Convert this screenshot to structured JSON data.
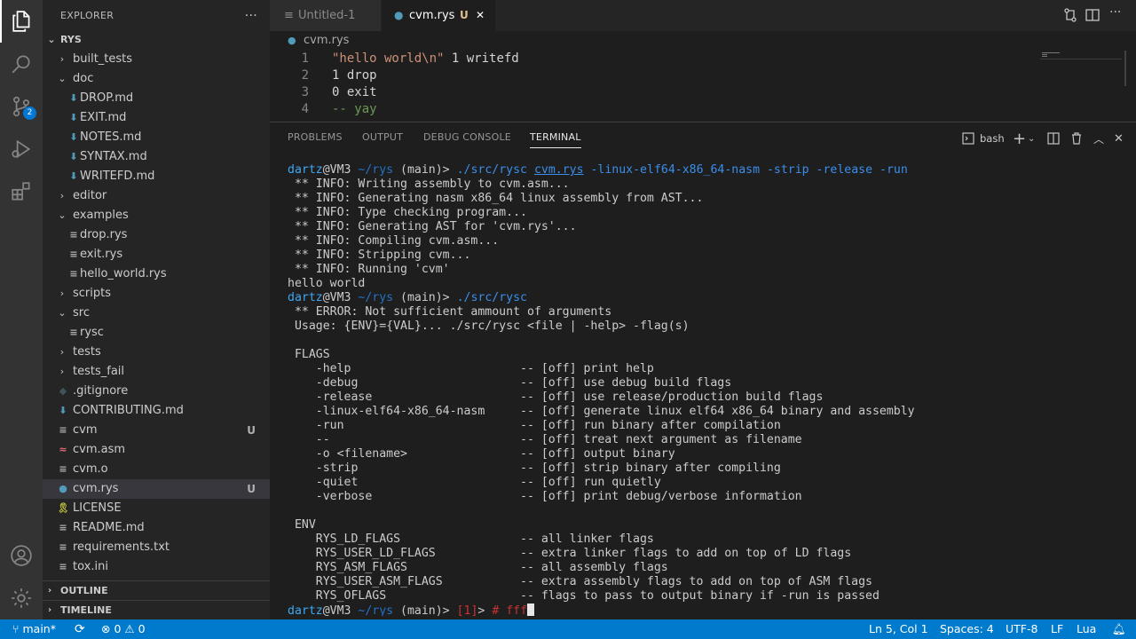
{
  "activity": {
    "source_control_badge": "2"
  },
  "sidebar": {
    "title": "EXPLORER",
    "more": "···",
    "root": "RYS",
    "tree": [
      {
        "label": "built_tests",
        "kind": "folder",
        "open": false,
        "depth": 0
      },
      {
        "label": "doc",
        "kind": "folder",
        "open": true,
        "depth": 0
      },
      {
        "label": "DROP.md",
        "kind": "md",
        "depth": 1
      },
      {
        "label": "EXIT.md",
        "kind": "md",
        "depth": 1
      },
      {
        "label": "NOTES.md",
        "kind": "md",
        "depth": 1
      },
      {
        "label": "SYNTAX.md",
        "kind": "md",
        "depth": 1
      },
      {
        "label": "WRITEFD.md",
        "kind": "md",
        "depth": 1
      },
      {
        "label": "editor",
        "kind": "folder",
        "open": false,
        "depth": 0
      },
      {
        "label": "examples",
        "kind": "folder",
        "open": true,
        "depth": 0
      },
      {
        "label": "drop.rys",
        "kind": "txt",
        "depth": 1
      },
      {
        "label": "exit.rys",
        "kind": "txt",
        "depth": 1
      },
      {
        "label": "hello_world.rys",
        "kind": "txt",
        "depth": 1
      },
      {
        "label": "scripts",
        "kind": "folder",
        "open": false,
        "depth": 0
      },
      {
        "label": "src",
        "kind": "folder",
        "open": true,
        "depth": 0
      },
      {
        "label": "rysc",
        "kind": "txt",
        "depth": 1
      },
      {
        "label": "tests",
        "kind": "folder",
        "open": false,
        "depth": 0
      },
      {
        "label": "tests_fail",
        "kind": "folder",
        "open": false,
        "depth": 0
      },
      {
        "label": ".gitignore",
        "kind": "git",
        "depth": 0
      },
      {
        "label": "CONTRIBUTING.md",
        "kind": "md",
        "depth": 0
      },
      {
        "label": "cvm",
        "kind": "txt",
        "depth": 0,
        "git": "U"
      },
      {
        "label": "cvm.asm",
        "kind": "asm",
        "depth": 0
      },
      {
        "label": "cvm.o",
        "kind": "txt",
        "depth": 0
      },
      {
        "label": "cvm.rys",
        "kind": "lua",
        "depth": 0,
        "git": "U",
        "selected": true
      },
      {
        "label": "LICENSE",
        "kind": "license",
        "depth": 0
      },
      {
        "label": "README.md",
        "kind": "txt",
        "depth": 0
      },
      {
        "label": "requirements.txt",
        "kind": "txt",
        "depth": 0
      },
      {
        "label": "tox.ini",
        "kind": "txt",
        "depth": 0
      }
    ],
    "outline": "OUTLINE",
    "timeline": "TIMELINE"
  },
  "tabs": {
    "tab1": "Untitled-1",
    "tab2": "cvm.rys",
    "tab2_status": "U",
    "close": "✕"
  },
  "breadcrumb": "cvm.rys",
  "editor": {
    "line_numbers": [
      "1",
      "2",
      "3",
      "4"
    ],
    "lines": [
      {
        "str": "\"hello world\\n\"",
        "rest": " 1 writefd"
      },
      {
        "str": "",
        "rest": "1 drop"
      },
      {
        "str": "",
        "rest": "0 exit"
      },
      {
        "str": "",
        "comment": "-- yay"
      }
    ]
  },
  "panel": {
    "tabs": [
      "PROBLEMS",
      "OUTPUT",
      "DEBUG CONSOLE",
      "TERMINAL"
    ],
    "active_tab": "TERMINAL",
    "shell": "bash"
  },
  "terminal": {
    "prompt_user": "dartz",
    "prompt_host": "@VM3",
    "prompt_path": " ~/rys",
    "prompt_branch": " (main)>",
    "cmd1_exe": "./src/rysc",
    "cmd1_file": "cvm.rys",
    "cmd1_flags": "-linux-elf64-x86_64-nasm -strip -release -run",
    "output1": " ** INFO: Writing assembly to cvm.asm...\n ** INFO: Generating nasm x86_64 linux assembly from AST...\n ** INFO: Type checking program...\n ** INFO: Generating AST for 'cvm.rys'...\n ** INFO: Compiling cvm.asm...\n ** INFO: Stripping cvm...\n ** INFO: Running 'cvm'\nhello world",
    "cmd2_exe": "./src/rysc",
    "output2": " ** ERROR: Not sufficient ammount of arguments\n Usage: {ENV}={VAL}... ./src/rysc <file | -help> -flag(s)\n\n FLAGS\n    -help                        -- [off] print help\n    -debug                       -- [off] use debug build flags\n    -release                     -- [off] use release/production build flags\n    -linux-elf64-x86_64-nasm     -- [off] generate linux elf64 x86_64 binary and assembly\n    -run                         -- [off] run binary after compilation\n    --                           -- [off] treat next argument as filename\n    -o <filename>                -- [off] output binary\n    -strip                       -- [off] strip binary after compiling\n    -quiet                       -- [off] run quietly\n    -verbose                     -- [off] print debug/verbose information\n\n ENV\n    RYS_LD_FLAGS                 -- all linker flags\n    RYS_USER_LD_FLAGS            -- extra linker flags to add on top of LD flags\n    RYS_ASM_FLAGS                -- all assembly flags\n    RYS_USER_ASM_FLAGS           -- extra assembly flags to add on top of ASM flags\n    RYS_OFLAGS                   -- flags to pass to output binary if -run is passed",
    "exit_code": "[1]",
    "exit_suffix": "> ",
    "typed": "# fff"
  },
  "status": {
    "branch": "main*",
    "errors": "0",
    "warnings": "0",
    "position": "Ln 5, Col 1",
    "spaces": "Spaces: 4",
    "encoding": "UTF-8",
    "eol": "LF",
    "language": "Lua"
  },
  "colors": {
    "accent": "#007acc",
    "md_icon": "#519aba",
    "lua_icon": "#519aba",
    "license_icon": "#cbcb41",
    "asm_icon": "#e06c75"
  }
}
